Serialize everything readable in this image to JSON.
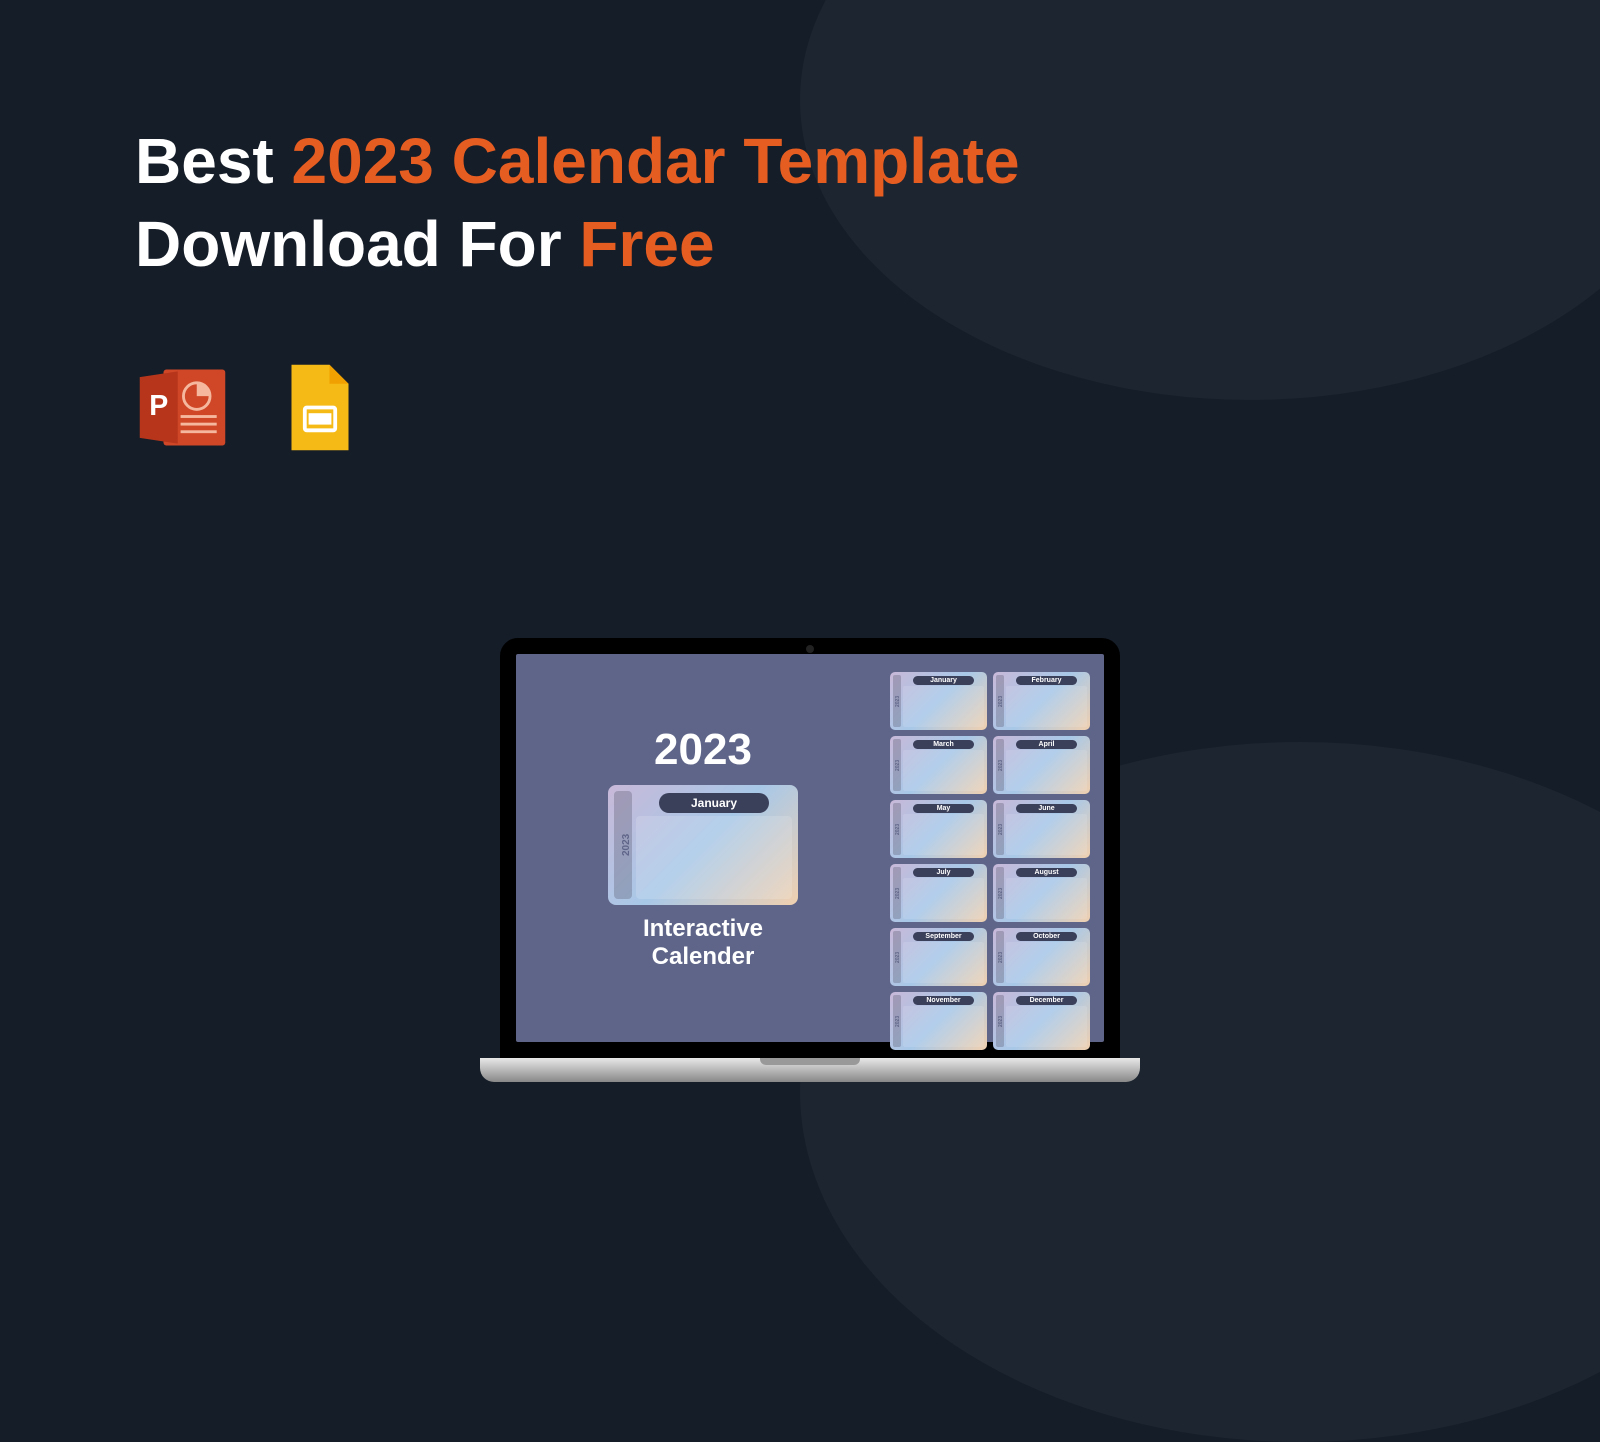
{
  "headline": {
    "w1": "Best ",
    "w2": "2023 Calendar Template",
    "w3": "Download For ",
    "w4": "Free"
  },
  "icons": {
    "powerpoint": "powerpoint-icon",
    "gslides": "google-slides-icon"
  },
  "screen": {
    "year": "2023",
    "featured_month": "January",
    "featured_year": "2023",
    "spine_year": "2023",
    "interactive_line1": "Interactive",
    "interactive_line2": "Calender"
  },
  "months": [
    "January",
    "February",
    "March",
    "April",
    "May",
    "June",
    "July",
    "August",
    "September",
    "October",
    "November",
    "December"
  ]
}
